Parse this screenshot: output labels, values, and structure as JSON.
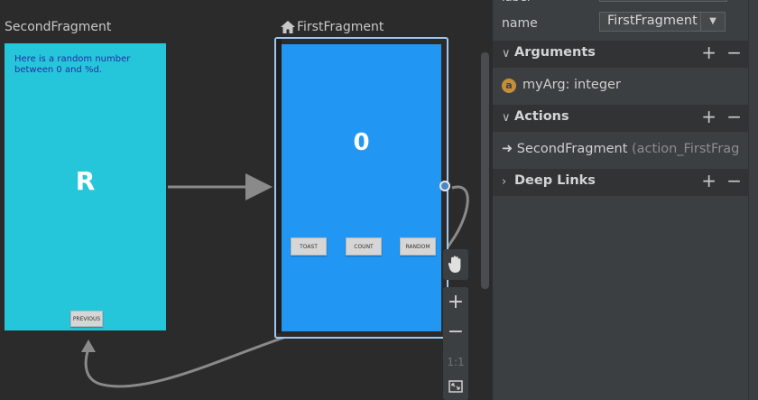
{
  "canvas": {
    "second_fragment": {
      "title": "SecondFragment",
      "message": "Here is a random number between 0 and %d.",
      "big_text": "R",
      "previous_button": "PREVIOUS"
    },
    "first_fragment": {
      "title": "FirstFragment",
      "count_text": "0",
      "buttons": [
        "TOAST",
        "COUNT",
        "RANDOM"
      ]
    },
    "toolbar": {
      "pan_icon": "hand-icon",
      "zoom_in": "+",
      "zoom_out": "−",
      "actual_size": "1:1",
      "fit_icon": "fit-screen-icon"
    },
    "colors": {
      "second_screen": "#26c6da",
      "first_screen": "#2196f3",
      "selection": "#9fc6ee"
    }
  },
  "attributes": {
    "top_row_label": "label",
    "name_label": "name",
    "name_value": "FirstFragment",
    "arguments_title": "Arguments",
    "argument_badge": "a",
    "argument_text": "myArg: integer",
    "actions_title": "Actions",
    "action_destination": "SecondFragment",
    "action_id": "(action_FirstFrag",
    "deep_links_title": "Deep Links",
    "add_symbol": "+",
    "remove_symbol": "−"
  }
}
